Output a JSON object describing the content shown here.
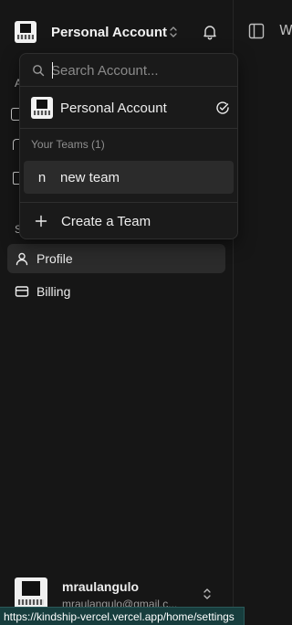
{
  "account_switcher": {
    "current_account": "Personal Account",
    "icons": {
      "toggle": "chevron-up-down-icon",
      "notifications": "bell-icon"
    }
  },
  "main": {
    "partial_text": "W",
    "sidebar_toggle_icon": "panel-left-icon"
  },
  "dropdown": {
    "search_placeholder": "Search Account...",
    "personal_label": "Personal Account",
    "teams_group_label": "Your Teams (1)",
    "teams": [
      {
        "initial": "n",
        "name": "new team"
      }
    ],
    "create_label": "Create a Team"
  },
  "nav": {
    "section_letter_a": "A",
    "section_letter_s": "S",
    "items": [
      {
        "label": "Profile",
        "icon": "user-icon",
        "active": true
      },
      {
        "label": "Billing",
        "icon": "credit-card-icon",
        "active": false
      }
    ]
  },
  "user": {
    "name": "mraulangulo",
    "email": "mraulangulo@gmail.c..."
  },
  "status_bar": {
    "url": "https://kindship-vercel.vercel.app/home/settings"
  },
  "colors": {
    "background": "#161616",
    "active_item": "#2b2b2b",
    "status_bar": "#173d3d"
  }
}
